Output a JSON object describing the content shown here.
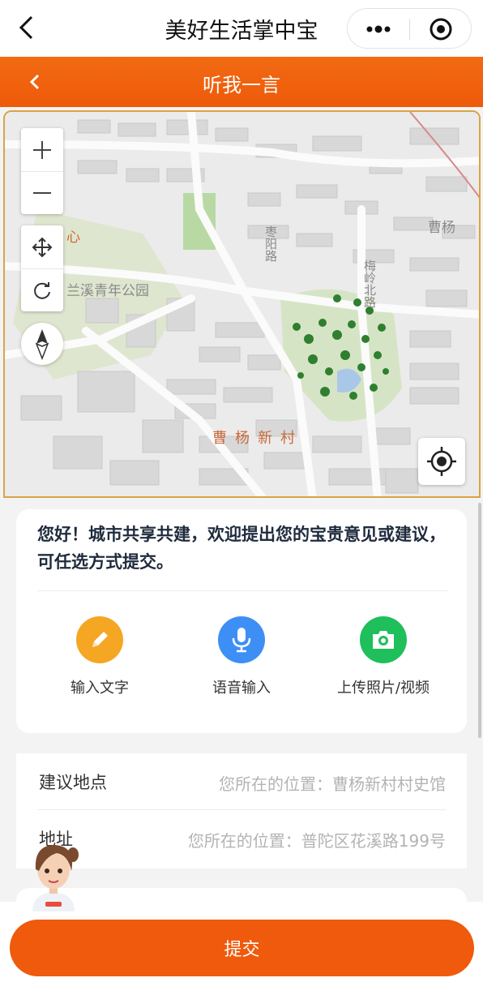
{
  "app": {
    "title": "美好生活掌中宝",
    "header_title": "听我一言"
  },
  "map": {
    "labels": {
      "park": "兰溪青年公园",
      "area": "曹杨",
      "road1": "枣阳路",
      "road2": "梅岭北路",
      "village": "曹杨新村",
      "heart": "心"
    }
  },
  "prompt": {
    "greeting": "您好！城市共享共建，欢迎提出您的宝贵意见或建议，可任选方式提交。",
    "options": [
      {
        "label": "输入文字",
        "icon": "pencil-icon",
        "color": "#f5a623"
      },
      {
        "label": "语音输入",
        "icon": "microphone-icon",
        "color": "#3d8ff5"
      },
      {
        "label": "上传照片/视频",
        "icon": "camera-icon",
        "color": "#1fbf5c"
      }
    ]
  },
  "form": {
    "rows": [
      {
        "key": "建议地点",
        "value": "您所在的位置：曹杨新村村史馆"
      },
      {
        "key": "地址",
        "value": "您所在的位置：普陀区花溪路199号"
      }
    ]
  },
  "actions": {
    "submit": "提交"
  }
}
